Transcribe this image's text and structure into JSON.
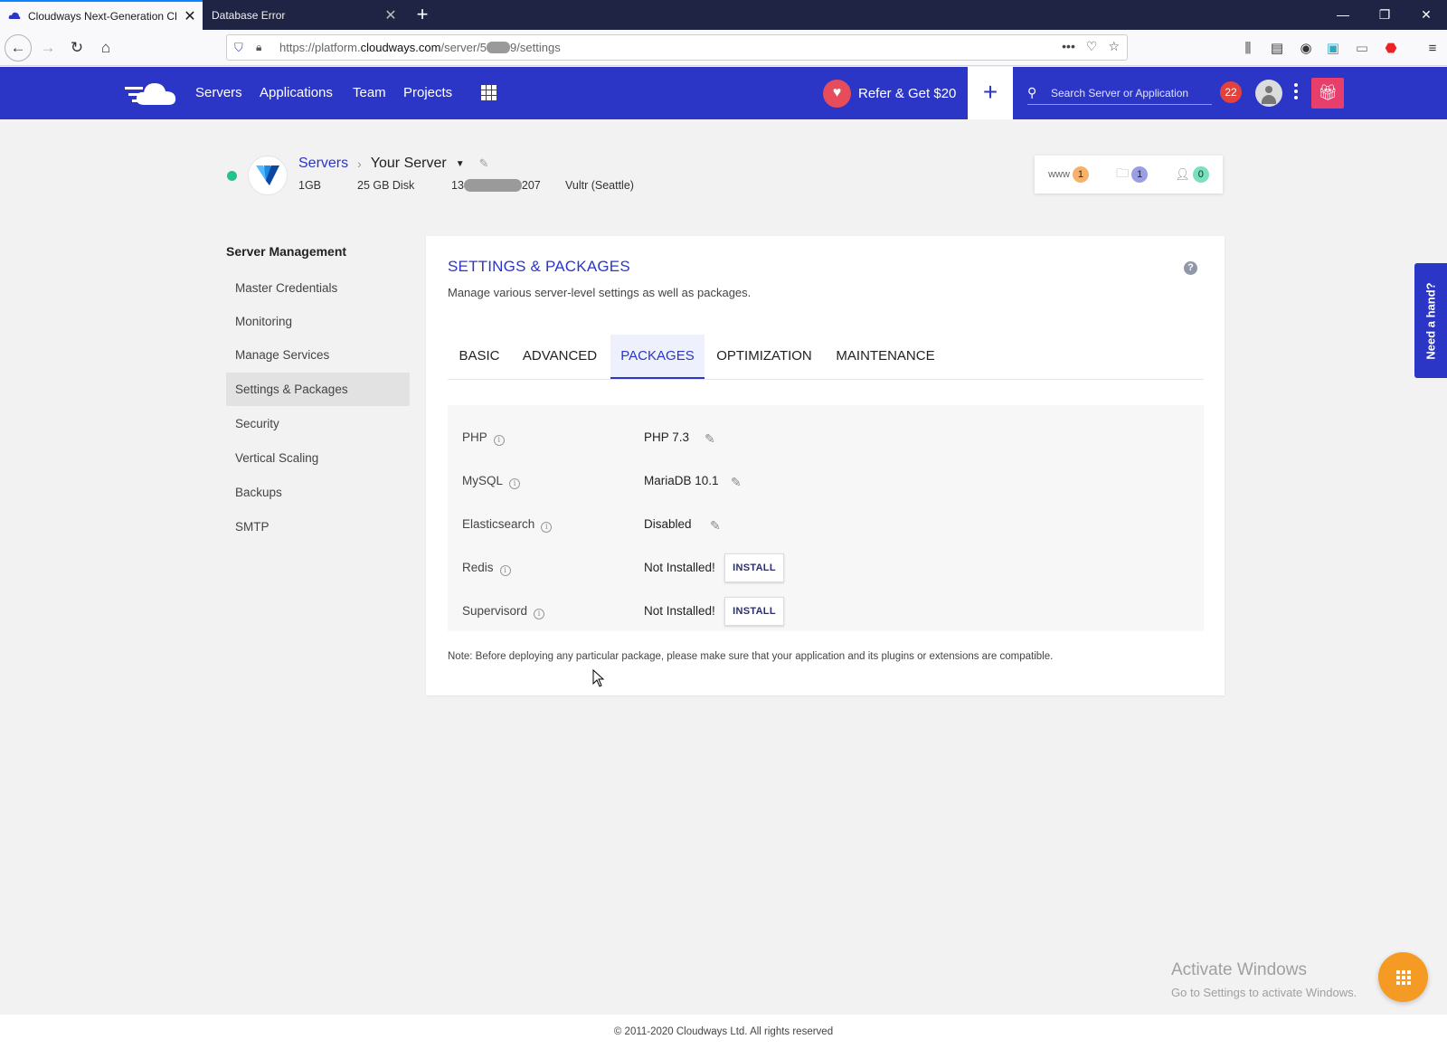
{
  "browser": {
    "tabs": [
      {
        "title": "Cloudways Next-Generation Cl",
        "active": true
      },
      {
        "title": "Database Error",
        "active": false
      }
    ],
    "url": {
      "prefix": "https://platform.",
      "domain": "cloudways.com",
      "path_a": "/server/5",
      "path_b": "9/settings"
    }
  },
  "header": {
    "nav": [
      "Servers",
      "Applications",
      "Team",
      "Projects"
    ],
    "refer_label": "Refer & Get $20",
    "plus_label": "+",
    "search_placeholder": "Search Server or Application",
    "notification_count": "22",
    "colors": {
      "primary": "#2b36c7",
      "notification": "#e2413c",
      "gift": "#e83e6c"
    }
  },
  "server": {
    "breadcrumb_root": "Servers",
    "name": "Your Server",
    "size": "1GB",
    "disk": "25 GB Disk",
    "ip_prefix": "13",
    "ip_suffix": "207",
    "provider": "Vultr (Seattle)",
    "status_color": "#22c38e",
    "counts": {
      "www": "1",
      "folders": "1",
      "users": "0"
    },
    "counts_www_label": "www"
  },
  "sidebar": {
    "title": "Server Management",
    "items": [
      {
        "label": "Master Credentials",
        "active": false
      },
      {
        "label": "Monitoring",
        "active": false
      },
      {
        "label": "Manage Services",
        "active": false
      },
      {
        "label": "Settings & Packages",
        "active": true
      },
      {
        "label": "Security",
        "active": false
      },
      {
        "label": "Vertical Scaling",
        "active": false
      },
      {
        "label": "Backups",
        "active": false
      },
      {
        "label": "SMTP",
        "active": false
      }
    ]
  },
  "main": {
    "title": "SETTINGS & PACKAGES",
    "subtitle": "Manage various server-level settings as well as packages.",
    "help_label": "?",
    "tabs": [
      "BASIC",
      "ADVANCED",
      "PACKAGES",
      "OPTIMIZATION",
      "MAINTENANCE"
    ],
    "active_tab": "PACKAGES",
    "packages": [
      {
        "name": "PHP",
        "value": "PHP 7.3",
        "action": "edit"
      },
      {
        "name": "MySQL",
        "value": "MariaDB 10.1",
        "action": "edit"
      },
      {
        "name": "Elasticsearch",
        "value": "Disabled",
        "action": "edit"
      },
      {
        "name": "Redis",
        "value": "Not Installed!",
        "action": "install"
      },
      {
        "name": "Supervisord",
        "value": "Not Installed!",
        "action": "install"
      }
    ],
    "install_label": "INSTALL",
    "note": "Note: Before deploying any particular package, please make sure that your application and its plugins or extensions are compatible."
  },
  "need_hand": "Need a hand?",
  "watermark": {
    "line1": "Activate Windows",
    "line2": "Go to Settings to activate Windows."
  },
  "footer": "© 2011-2020 Cloudways Ltd. All rights reserved"
}
